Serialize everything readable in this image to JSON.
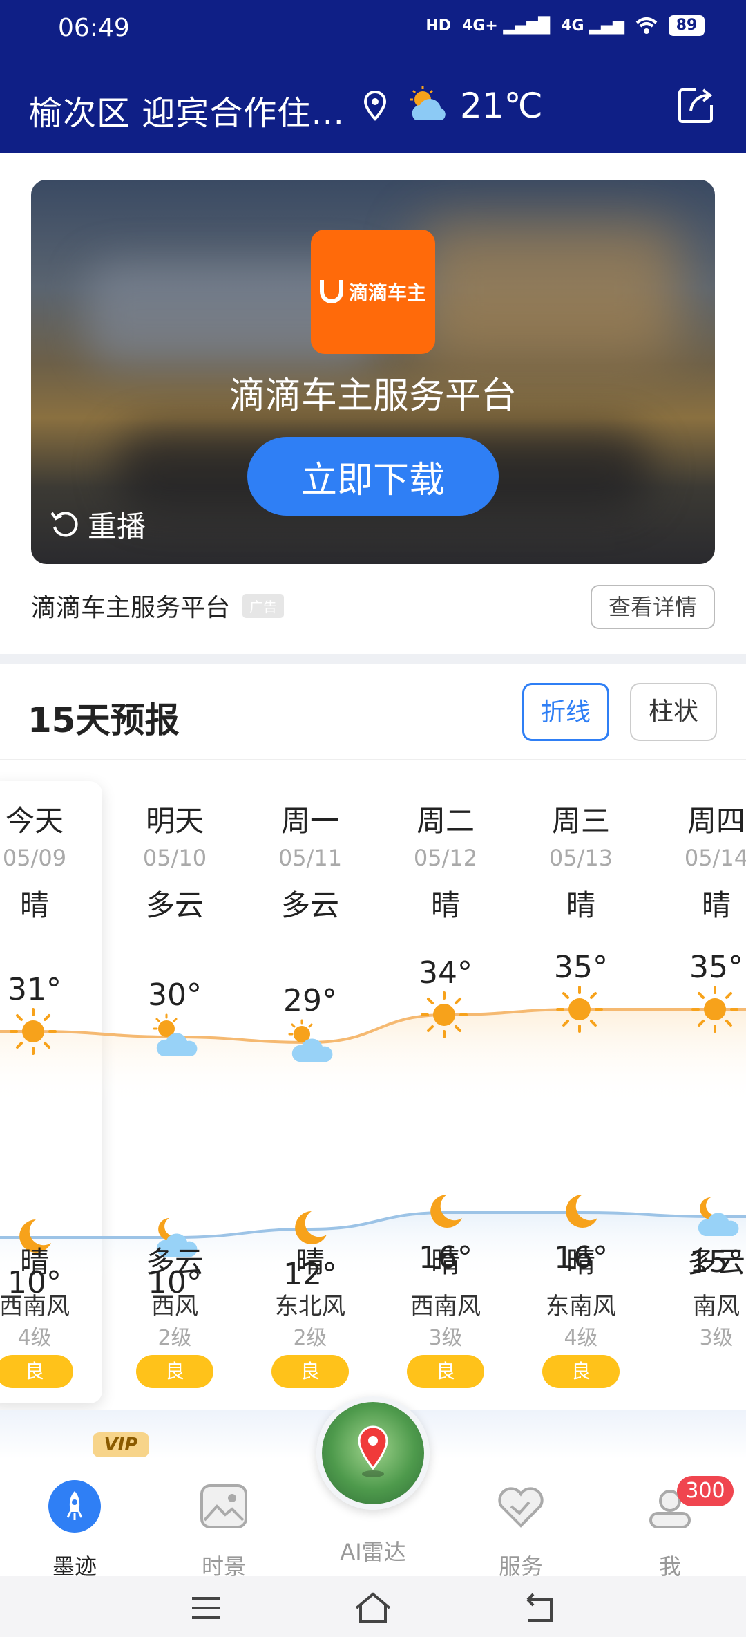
{
  "status_bar": {
    "time": "06:49",
    "hd": "HD",
    "net1": "4G+",
    "net2": "4G",
    "battery": "89"
  },
  "header": {
    "location": "榆次区 迎宾合作住…",
    "temperature": "21℃"
  },
  "ad": {
    "logo_text": "滴滴车主",
    "title": "滴滴车主服务平台",
    "download_label": "立即下载",
    "replay_label": "重播",
    "caption": "滴滴车主服务平台",
    "tag": "广告",
    "detail_label": "查看详情"
  },
  "forecast": {
    "title": "15天预报",
    "toggle_line": "折线",
    "toggle_bar": "柱状",
    "days": [
      {
        "name": "今天",
        "date": "05/09",
        "day_cond": "晴",
        "high": "31°",
        "low": "10°",
        "night_cond": "晴",
        "wind": "西南风",
        "level": "4级",
        "aqi": "良",
        "day_icon": "sun-icon",
        "night_icon": "moon-icon"
      },
      {
        "name": "明天",
        "date": "05/10",
        "day_cond": "多云",
        "high": "30°",
        "low": "10°",
        "night_cond": "多云",
        "wind": "西风",
        "level": "2级",
        "aqi": "良",
        "day_icon": "partly-cloudy-icon",
        "night_icon": "cloudy-night-icon"
      },
      {
        "name": "周一",
        "date": "05/11",
        "day_cond": "多云",
        "high": "29°",
        "low": "12°",
        "night_cond": "晴",
        "wind": "东北风",
        "level": "2级",
        "aqi": "良",
        "day_icon": "partly-cloudy-icon",
        "night_icon": "moon-icon"
      },
      {
        "name": "周二",
        "date": "05/12",
        "day_cond": "晴",
        "high": "34°",
        "low": "16°",
        "night_cond": "晴",
        "wind": "西南风",
        "level": "3级",
        "aqi": "良",
        "day_icon": "sun-icon",
        "night_icon": "moon-icon"
      },
      {
        "name": "周三",
        "date": "05/13",
        "day_cond": "晴",
        "high": "35°",
        "low": "16°",
        "night_cond": "晴",
        "wind": "东南风",
        "level": "4级",
        "aqi": "良",
        "day_icon": "sun-icon",
        "night_icon": "moon-icon"
      },
      {
        "name": "周四",
        "date": "05/14",
        "day_cond": "晴",
        "high": "35°",
        "low": "15°",
        "night_cond": "多云",
        "wind": "南风",
        "level": "3级",
        "aqi": "",
        "day_icon": "sun-icon",
        "night_icon": "cloudy-night-icon"
      }
    ]
  },
  "vip_label": "VIP",
  "nav": {
    "items": [
      {
        "label": "墨迹",
        "icon": "rocket-icon"
      },
      {
        "label": "时景",
        "icon": "photo-icon"
      },
      {
        "label": "AI雷达",
        "icon": "radar-map-icon"
      },
      {
        "label": "服务",
        "icon": "heart-handshake-icon"
      },
      {
        "label": "我",
        "icon": "profile-icon",
        "badge": "300"
      }
    ]
  },
  "colors": {
    "header_bg": "#0f1f86",
    "accent_blue": "#2f7ff5",
    "aqi_yellow": "#ffc21a",
    "sun_orange": "#f7a21b",
    "high_curve": "#f5b971",
    "low_curve": "#9cc3e6"
  }
}
